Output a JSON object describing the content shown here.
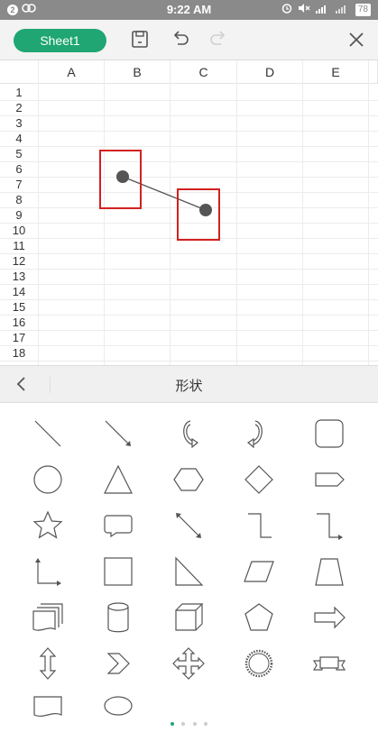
{
  "status_bar": {
    "time": "9:22 AM",
    "notif_count": "2",
    "battery": "78"
  },
  "toolbar": {
    "sheet_label": "Sheet1"
  },
  "grid": {
    "columns": [
      "A",
      "B",
      "C",
      "D",
      "E"
    ],
    "rows": [
      "1",
      "2",
      "3",
      "4",
      "5",
      "6",
      "7",
      "8",
      "9",
      "10",
      "11",
      "12",
      "13",
      "14",
      "15",
      "16",
      "17",
      "18"
    ]
  },
  "panel": {
    "title": "形状"
  },
  "shapes": [
    "line-icon",
    "arrow-line-icon",
    "curved-arrow-left-icon",
    "curved-arrow-right-icon",
    "rounded-rectangle-icon",
    "circle-icon",
    "triangle-icon",
    "hexagon-icon",
    "diamond-icon",
    "pentagon-arrow-icon",
    "star-icon",
    "speech-bubble-icon",
    "double-arrow-line-icon",
    "elbow-connector-icon",
    "elbow-arrow-connector-icon",
    "elbow-double-arrow-icon",
    "square-icon",
    "right-triangle-icon",
    "parallelogram-icon",
    "trapezoid-icon",
    "multi-document-icon",
    "cylinder-icon",
    "cube-icon",
    "pentagon-icon",
    "right-arrow-icon",
    "up-down-arrow-icon",
    "chevron-icon",
    "four-way-arrow-icon",
    "seal-icon",
    "ribbon-icon",
    "document-icon",
    "oval-callout-icon"
  ],
  "colors": {
    "accent": "#1fa672",
    "selection": "#d32020"
  }
}
